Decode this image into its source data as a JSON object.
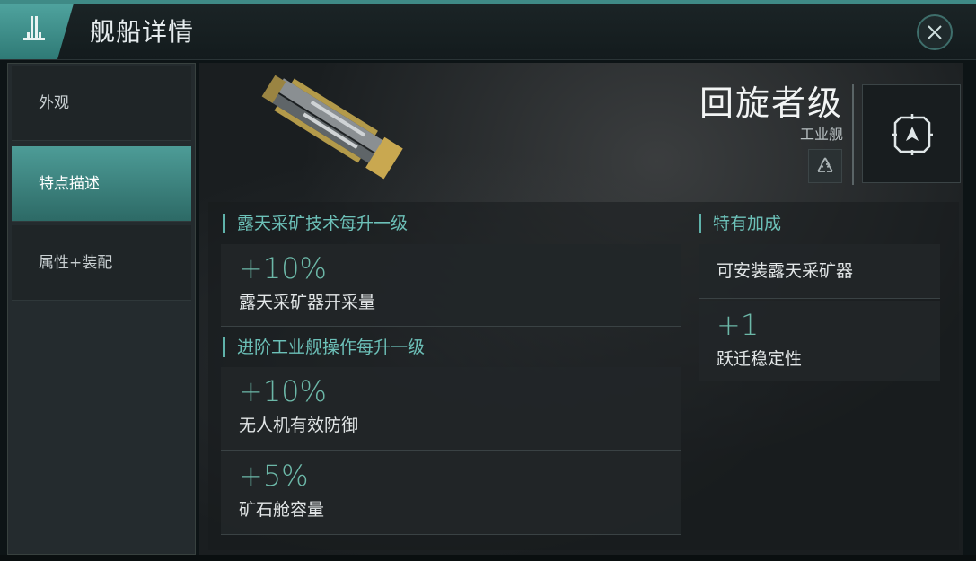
{
  "window": {
    "title": "舰船详情"
  },
  "sidebar": {
    "items": [
      {
        "label": "外观",
        "active": false
      },
      {
        "label": "特点描述",
        "active": true
      },
      {
        "label": "属性+装配",
        "active": false
      }
    ]
  },
  "ship": {
    "name": "回旋者级",
    "class": "工业舰"
  },
  "sections": {
    "left": [
      {
        "title": "露天采矿技术每升一级",
        "bonuses": [
          {
            "value": "+10%",
            "desc": "露天采矿器开采量"
          }
        ]
      },
      {
        "title": "进阶工业舰操作每升一级",
        "bonuses": [
          {
            "value": "+10%",
            "desc": "无人机有效防御"
          },
          {
            "value": "+5%",
            "desc": "矿石舱容量"
          }
        ]
      }
    ],
    "right": {
      "title": "特有加成",
      "item_plain": "可安装露天采矿器",
      "bonus": {
        "value": "+1",
        "desc": "跃迁稳定性"
      }
    }
  },
  "colors": {
    "accent": "#4d9c97",
    "value_text": "#6cb8a8",
    "section_title": "#6cc0b8"
  },
  "icons": [
    "ship-class-icon",
    "close-icon",
    "recycle-icon",
    "target-icon"
  ]
}
